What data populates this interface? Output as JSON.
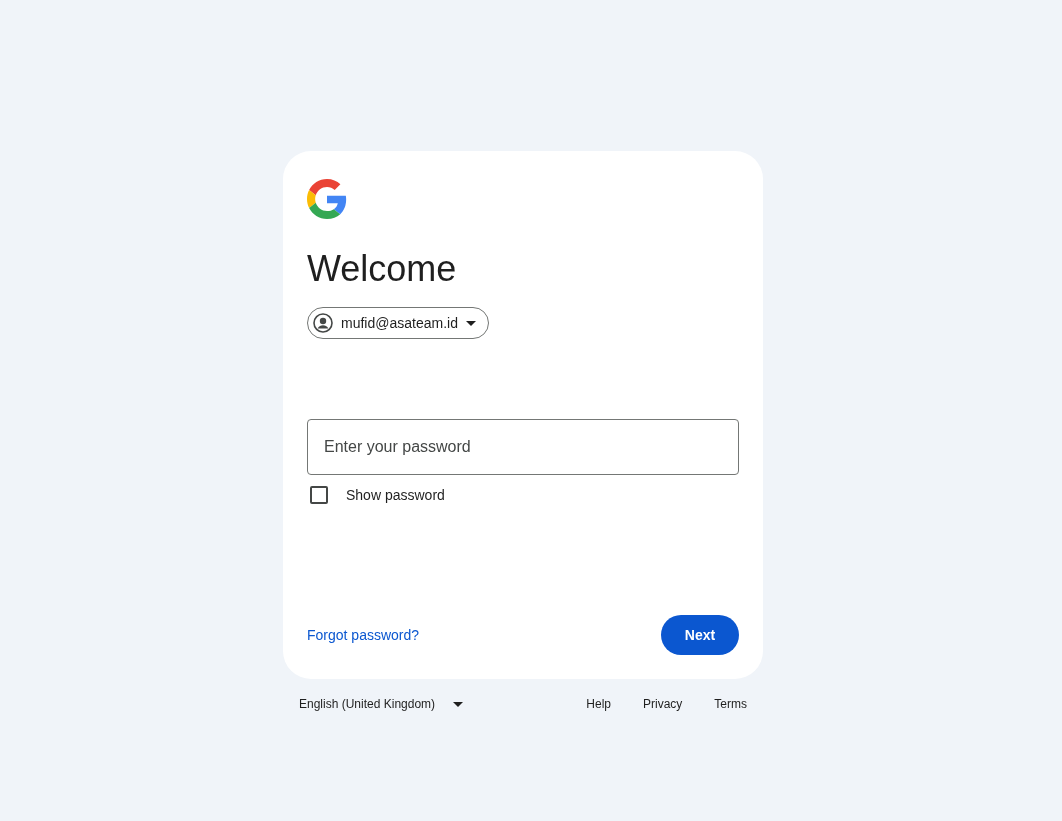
{
  "card": {
    "title": "Welcome",
    "account": {
      "email": "mufid@asateam.id"
    },
    "password": {
      "placeholder": "Enter your password"
    },
    "show_password": {
      "label": "Show password",
      "checked": false
    },
    "forgot_link": "Forgot password?",
    "next_button": "Next"
  },
  "footer": {
    "language": "English (United Kingdom)",
    "links": [
      "Help",
      "Privacy",
      "Terms"
    ]
  }
}
